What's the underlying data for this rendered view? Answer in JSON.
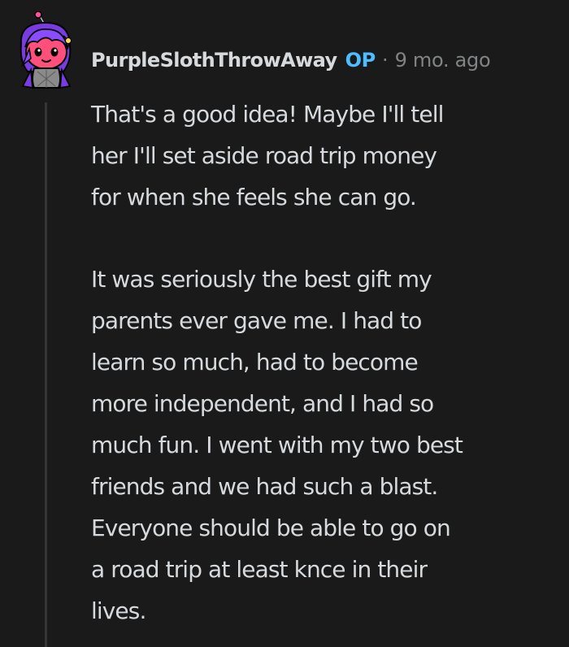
{
  "comment": {
    "username": "PurpleSlothThrowAway",
    "op_badge": "OP",
    "separator": "·",
    "timestamp": "9 mo. ago",
    "avatar_icon": "snoo-avatar-icon",
    "paragraphs": [
      {
        "lines": [
          "That's a good idea! Maybe I'll tell",
          "her I'll set aside road trip money",
          "for when she feels she can go."
        ]
      },
      {
        "lines": [
          "It was seriously the best gift my",
          "parents ever gave me. I had to",
          "learn so much, had to become",
          "more independent, and I had so",
          "much fun. I went with my two best",
          "friends and we had such a blast.",
          "Everyone should be able to go on",
          "a road trip at least knce in their",
          "lives."
        ]
      }
    ]
  },
  "colors": {
    "background": "#1a1a1b",
    "text": "#d7dadc",
    "op_badge": "#4fbcff",
    "meta": "#818384",
    "thread_line": "#343536"
  }
}
